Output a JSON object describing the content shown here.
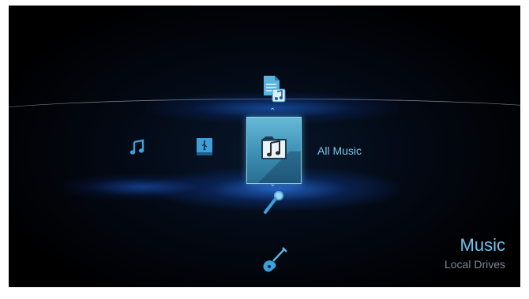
{
  "menu": {
    "selected_label": "All Music"
  },
  "header": {
    "title": "Music",
    "subtitle": "Local Drives"
  },
  "icons": {
    "horizontal": [
      "music-note-icon",
      "usb-drive-icon",
      "music-folder-icon"
    ],
    "vertical": [
      "playlist-icon",
      "music-folder-icon",
      "microphone-icon",
      "guitar-icon"
    ]
  },
  "colors": {
    "accent": "#6cc2ee",
    "selection": "#4da3c6",
    "subtitle": "#7a8894",
    "background": "#000000"
  }
}
